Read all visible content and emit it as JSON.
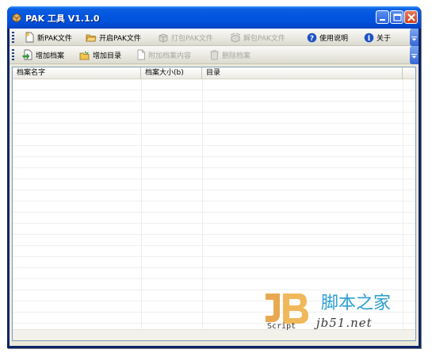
{
  "window": {
    "title": "PAK 工具 V1.1.0",
    "colors": {
      "titlebar": "#0052dc",
      "face": "#ece9d8",
      "close": "#c8401c"
    }
  },
  "toolbar1": {
    "items": [
      {
        "label": "新PAK文件",
        "icon": "new-file-icon",
        "enabled": true
      },
      {
        "label": "开启PAK文件",
        "icon": "open-folder-icon",
        "enabled": true
      },
      {
        "label": "打包PAK文件",
        "icon": "pack-icon",
        "enabled": false
      },
      {
        "label": "解包PAK文件",
        "icon": "unpack-icon",
        "enabled": false
      },
      {
        "label": "使用说明",
        "icon": "help-icon",
        "enabled": true
      },
      {
        "label": "关于",
        "icon": "info-icon",
        "enabled": true
      }
    ]
  },
  "toolbar2": {
    "items": [
      {
        "label": "增加档案",
        "icon": "add-file-icon",
        "enabled": true
      },
      {
        "label": "增加目录",
        "icon": "add-folder-icon",
        "enabled": true
      },
      {
        "label": "附加档案内容",
        "icon": "attach-content-icon",
        "enabled": false
      },
      {
        "label": "删除档案",
        "icon": "delete-file-icon",
        "enabled": false
      }
    ]
  },
  "list": {
    "columns": [
      "档案名字",
      "档案大小(b)",
      "目录"
    ],
    "rows": []
  },
  "watermark": {
    "logo_text": "Script",
    "site_name": "脚本之家",
    "url": "jb51.net"
  }
}
